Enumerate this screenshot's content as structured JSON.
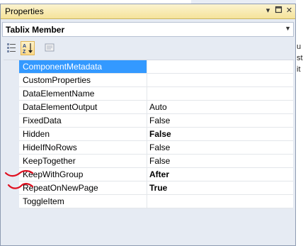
{
  "panel": {
    "title": "Properties",
    "buttons": {
      "dropdown": "▾",
      "pin": "⊓",
      "close": "✕"
    }
  },
  "object_selector": {
    "value": "Tablix Member",
    "dropdown_icon": "chevron-down-icon"
  },
  "toolbar": {
    "items": [
      {
        "name": "categorized-button",
        "icon": "categorized-icon"
      },
      {
        "name": "alphabetical-button",
        "icon": "alphabetical-icon",
        "active": true
      },
      {
        "name": "property-pages-button",
        "icon": "property-pages-icon"
      }
    ]
  },
  "properties": [
    {
      "name": "ComponentMetadata",
      "value": "",
      "selected": true,
      "bold": false
    },
    {
      "name": "CustomProperties",
      "value": "",
      "bold": false
    },
    {
      "name": "DataElementName",
      "value": "",
      "bold": false
    },
    {
      "name": "DataElementOutput",
      "value": "Auto",
      "bold": false
    },
    {
      "name": "FixedData",
      "value": "False",
      "bold": false
    },
    {
      "name": "Hidden",
      "value": "False",
      "bold": true
    },
    {
      "name": "HideIfNoRows",
      "value": "False",
      "bold": false
    },
    {
      "name": "KeepTogether",
      "value": "False",
      "bold": false
    },
    {
      "name": "KeepWithGroup",
      "value": "After",
      "bold": true
    },
    {
      "name": "RepeatOnNewPage",
      "value": "True",
      "bold": true
    },
    {
      "name": "ToggleItem",
      "value": "",
      "bold": false
    }
  ],
  "background_fragments": [
    "u",
    "st",
    "it"
  ],
  "colors": {
    "selection": "#3399ff",
    "annotation": "#e01020",
    "titlebar": "#f5e39a"
  }
}
